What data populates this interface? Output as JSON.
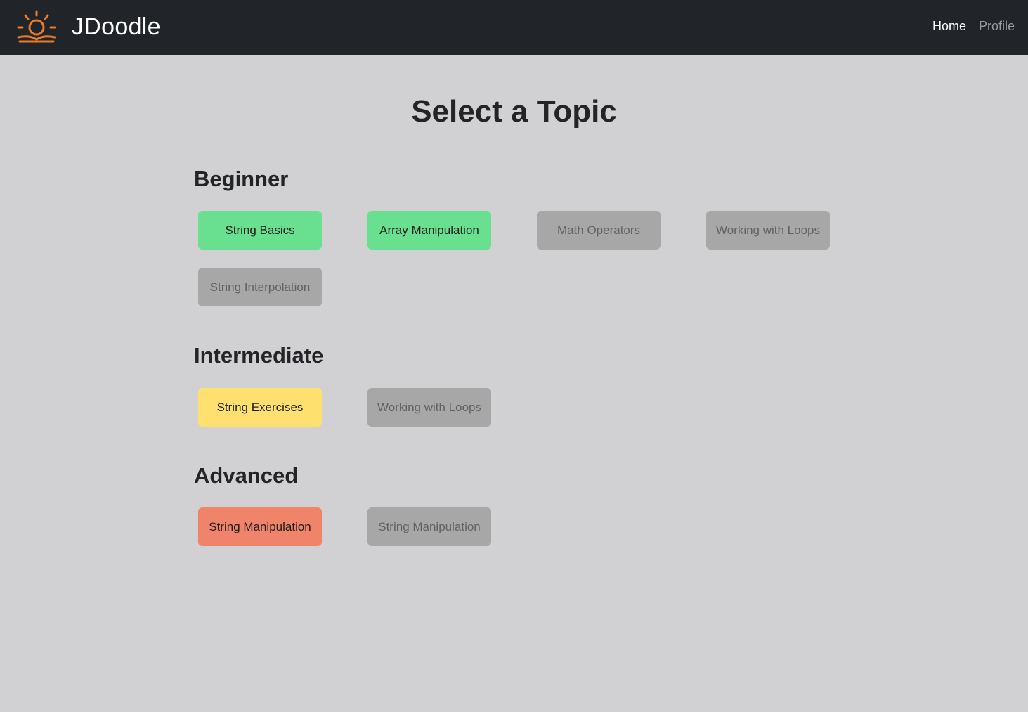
{
  "navbar": {
    "brand_name": "JDoodle",
    "links": [
      {
        "label": "Home",
        "active": true
      },
      {
        "label": "Profile",
        "active": false
      }
    ],
    "logo_icon": "sunrise-book-icon",
    "logo_color": "#e87b2c"
  },
  "main": {
    "title": "Select a Topic",
    "sections": [
      {
        "title": "Beginner",
        "topics": [
          {
            "label": "String Basics",
            "status": "completed"
          },
          {
            "label": "Array Manipulation",
            "status": "completed"
          },
          {
            "label": "Math Operators",
            "status": "locked"
          },
          {
            "label": "Working with Loops",
            "status": "locked"
          },
          {
            "label": "String Interpolation",
            "status": "locked"
          }
        ]
      },
      {
        "title": "Intermediate",
        "topics": [
          {
            "label": "String Exercises",
            "status": "available"
          },
          {
            "label": "Working with Loops",
            "status": "locked"
          }
        ]
      },
      {
        "title": "Advanced",
        "topics": [
          {
            "label": "String Manipulation",
            "status": "available"
          },
          {
            "label": "String Manipulation",
            "status": "locked"
          }
        ]
      }
    ]
  },
  "colors": {
    "navbar_bg": "#212429",
    "page_bg": "#d1d1d3",
    "beginner_accent": "#69e08f",
    "intermediate_accent": "#fde06d",
    "advanced_accent": "#f0846a",
    "locked": "#a7a7a7"
  }
}
